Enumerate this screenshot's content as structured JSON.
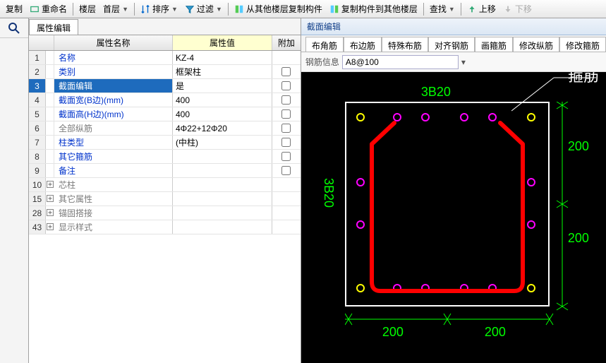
{
  "toolbar": {
    "items": [
      "复制",
      "重命名",
      "楼层",
      "首层",
      "排序",
      "过滤",
      "从其他楼层复制构件",
      "复制构件到其他楼层",
      "查找",
      "上移",
      "下移"
    ]
  },
  "left_tab": "属性编辑",
  "prop_header": {
    "name": "属性名称",
    "value": "属性值",
    "extra": "附加"
  },
  "props": [
    {
      "n": "1",
      "name": "名称",
      "val": "KZ-4",
      "cls": "blue-text",
      "chk": false
    },
    {
      "n": "2",
      "name": "类别",
      "val": "框架柱",
      "cls": "blue-text",
      "chk": true
    },
    {
      "n": "3",
      "name": "截面编辑",
      "val": "是",
      "cls": "",
      "sel": true,
      "chk": true
    },
    {
      "n": "4",
      "name": "截面宽(B边)(mm)",
      "val": "400",
      "cls": "blue-text",
      "chk": true
    },
    {
      "n": "5",
      "name": "截面高(H边)(mm)",
      "val": "400",
      "cls": "blue-text",
      "chk": true
    },
    {
      "n": "6",
      "name": "全部纵筋",
      "val": "4Φ22+12Φ20",
      "cls": "gray-text",
      "chk": true
    },
    {
      "n": "7",
      "name": "柱类型",
      "val": "(中柱)",
      "cls": "blue-text",
      "chk": true
    },
    {
      "n": "8",
      "name": "其它箍筋",
      "val": "",
      "cls": "blue-text",
      "chk": true
    },
    {
      "n": "9",
      "name": "备注",
      "val": "",
      "cls": "blue-text",
      "chk": true
    },
    {
      "n": "10",
      "name": "芯柱",
      "val": "",
      "exp": "+",
      "cls": "gray-text",
      "chk": false
    },
    {
      "n": "15",
      "name": "其它属性",
      "val": "",
      "exp": "+",
      "cls": "gray-text",
      "chk": false
    },
    {
      "n": "28",
      "name": "锚固搭接",
      "val": "",
      "exp": "+",
      "cls": "gray-text",
      "chk": false
    },
    {
      "n": "43",
      "name": "显示样式",
      "val": "",
      "exp": "+",
      "cls": "gray-text",
      "chk": false
    }
  ],
  "right_panel": {
    "title": "截面编辑",
    "sub_tabs": [
      "布角筋",
      "布边筋",
      "特殊布筋",
      "对齐钢筋",
      "画箍筋",
      "修改纵筋",
      "修改箍筋"
    ],
    "field_label": "钢筋信息",
    "field_value": "A8@100"
  },
  "section": {
    "top_label": "3B20",
    "left_label": "3B20",
    "callout": "箍筋",
    "dims": [
      "200",
      "200",
      "200",
      "200"
    ]
  }
}
